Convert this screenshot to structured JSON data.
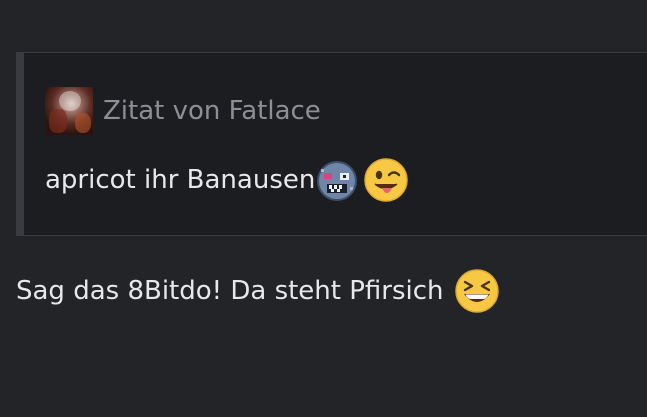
{
  "quote": {
    "author_label": "Zitat von Fatlace",
    "text": "apricot ihr Banausen",
    "emojis": [
      "robot-smiley-icon",
      "winking-face-with-tongue-icon"
    ]
  },
  "message": {
    "text": "Sag das 8Bitdo! Da steht Pfirsich",
    "emojis": [
      "grinning-squinting-face-icon"
    ]
  }
}
